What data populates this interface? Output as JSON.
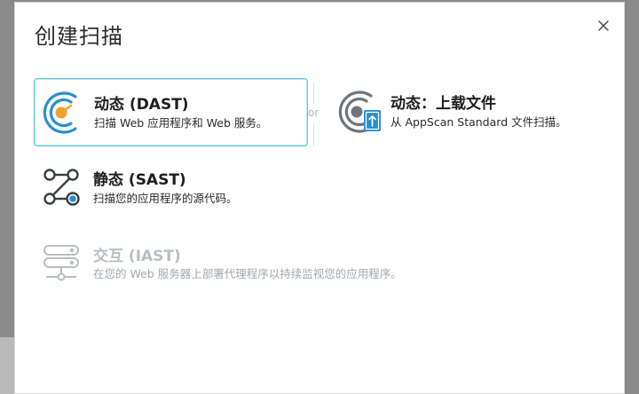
{
  "dialog": {
    "title": "创建扫描",
    "close_glyph": "×"
  },
  "divider_text": "or",
  "options": {
    "dast": {
      "title": "动态 (DAST)",
      "description": "扫描 Web 应用程序和 Web 服务。",
      "icon": "radar-target-icon",
      "selected": true
    },
    "dast_upload": {
      "title": "动态：上载文件",
      "description": "从 AppScan Standard 文件扫描。",
      "icon": "radar-upload-file-icon"
    },
    "sast": {
      "title": "静态 (SAST)",
      "description": "扫描您的应用程序的源代码。",
      "icon": "code-nodes-icon"
    },
    "iast": {
      "title": "交互 (IAST)",
      "description": "在您的 Web 服务器上部署代理程序以持续监视您的应用程序。",
      "icon": "server-stack-icon",
      "disabled": true
    }
  },
  "colors": {
    "accent": "#63c4e7",
    "icon_blue": "#2a8fd0",
    "icon_orange": "#f0a030",
    "icon_gray": "#6f757b",
    "disabled_gray": "#b9bec3"
  }
}
